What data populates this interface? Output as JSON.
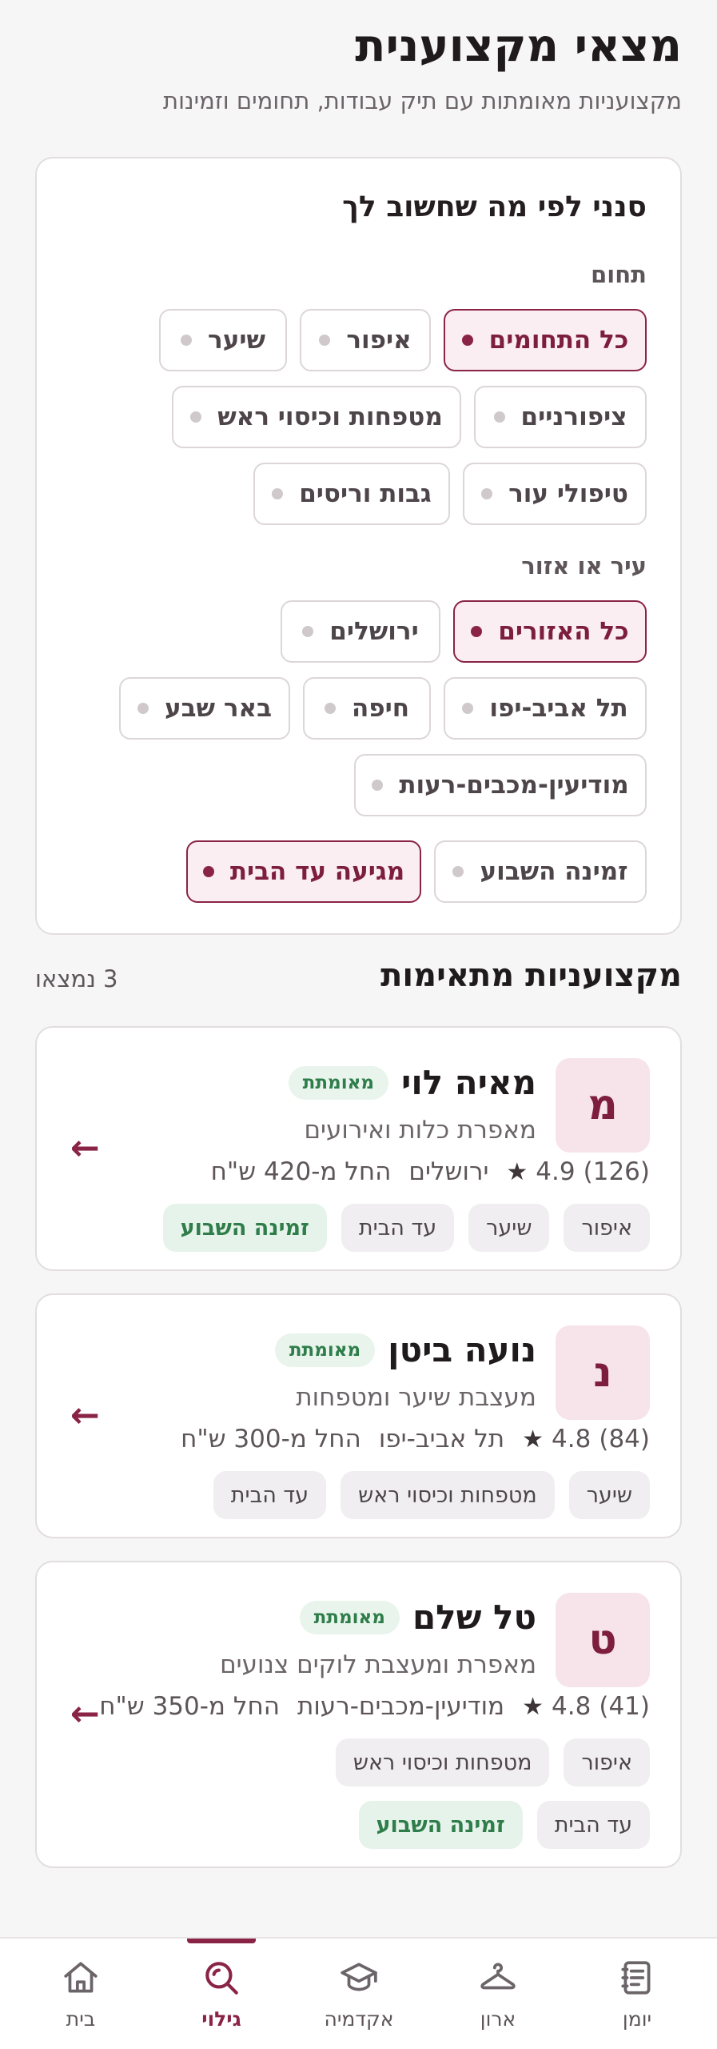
{
  "header": {
    "title": "מצאי מקצוענית",
    "subtitle": "מקצועניות מאומתות עם תיק עבודות, תחומים וזמינות"
  },
  "filters": {
    "title": "סנני לפי מה שחשוב לך",
    "field_label": "תחום",
    "fields": [
      {
        "label": "כל התחומים",
        "selected": true
      },
      {
        "label": "איפור",
        "selected": false
      },
      {
        "label": "שיער",
        "selected": false
      },
      {
        "label": "ציפורניים",
        "selected": false
      },
      {
        "label": "מטפחות וכיסוי ראש",
        "selected": false
      },
      {
        "label": "טיפולי עור",
        "selected": false
      },
      {
        "label": "גבות וריסים",
        "selected": false
      }
    ],
    "area_label": "עיר או אזור",
    "areas": [
      {
        "label": "כל האזורים",
        "selected": true
      },
      {
        "label": "ירושלים",
        "selected": false
      },
      {
        "label": "תל אביב-יפו",
        "selected": false
      },
      {
        "label": "חיפה",
        "selected": false
      },
      {
        "label": "באר שבע",
        "selected": false
      },
      {
        "label": "מודיעין-מכבים-רעות",
        "selected": false
      }
    ],
    "toggles": [
      {
        "label": "זמינה השבוע",
        "selected": false
      },
      {
        "label": "מגיעה עד הבית",
        "selected": true
      }
    ]
  },
  "results": {
    "title": "מקצועניות מתאימות",
    "count": "3 נמצאו",
    "items": [
      {
        "initial": "מ",
        "name": "מאיה לוי",
        "badge": "מאומתת",
        "role": "מאפרת כלות ואירועים",
        "rating": "4.9",
        "reviews": "(126)",
        "city": "ירושלים",
        "price": "החל מ-420 ש\"ח",
        "tags": [
          "איפור",
          "שיער",
          "עד הבית"
        ],
        "availability": "זמינה השבוע"
      },
      {
        "initial": "נ",
        "name": "נועה ביטן",
        "badge": "מאומתת",
        "role": "מעצבת שיער ומטפחות",
        "rating": "4.8",
        "reviews": "(84)",
        "city": "תל אביב-יפו",
        "price": "החל מ-300 ש\"ח",
        "tags": [
          "שיער",
          "מטפחות וכיסוי ראש",
          "עד הבית"
        ],
        "availability": ""
      },
      {
        "initial": "ט",
        "name": "טל שלם",
        "badge": "מאומתת",
        "role": "מאפרת ומעצבת לוקים צנועים",
        "rating": "4.8",
        "reviews": "(41)",
        "city": "מודיעין-מכבים-רעות",
        "price": "החל מ-350 ש\"ח",
        "tags": [
          "איפור",
          "מטפחות וכיסוי ראש",
          "עד הבית"
        ],
        "availability": "זמינה השבוע"
      }
    ],
    "arrow_glyph": "←"
  },
  "nav": {
    "items": [
      {
        "label": "בית",
        "icon": "home-icon",
        "active": false
      },
      {
        "label": "גילוי",
        "icon": "search-icon",
        "active": true
      },
      {
        "label": "אקדמיה",
        "icon": "graduation-cap-icon",
        "active": false
      },
      {
        "label": "ארון",
        "icon": "hanger-icon",
        "active": false
      },
      {
        "label": "יומן",
        "icon": "journal-icon",
        "active": false
      }
    ]
  },
  "colors": {
    "accent": "#8a2446",
    "accent_soft": "#fbeef2",
    "verified_green": "#2f7d4a"
  }
}
